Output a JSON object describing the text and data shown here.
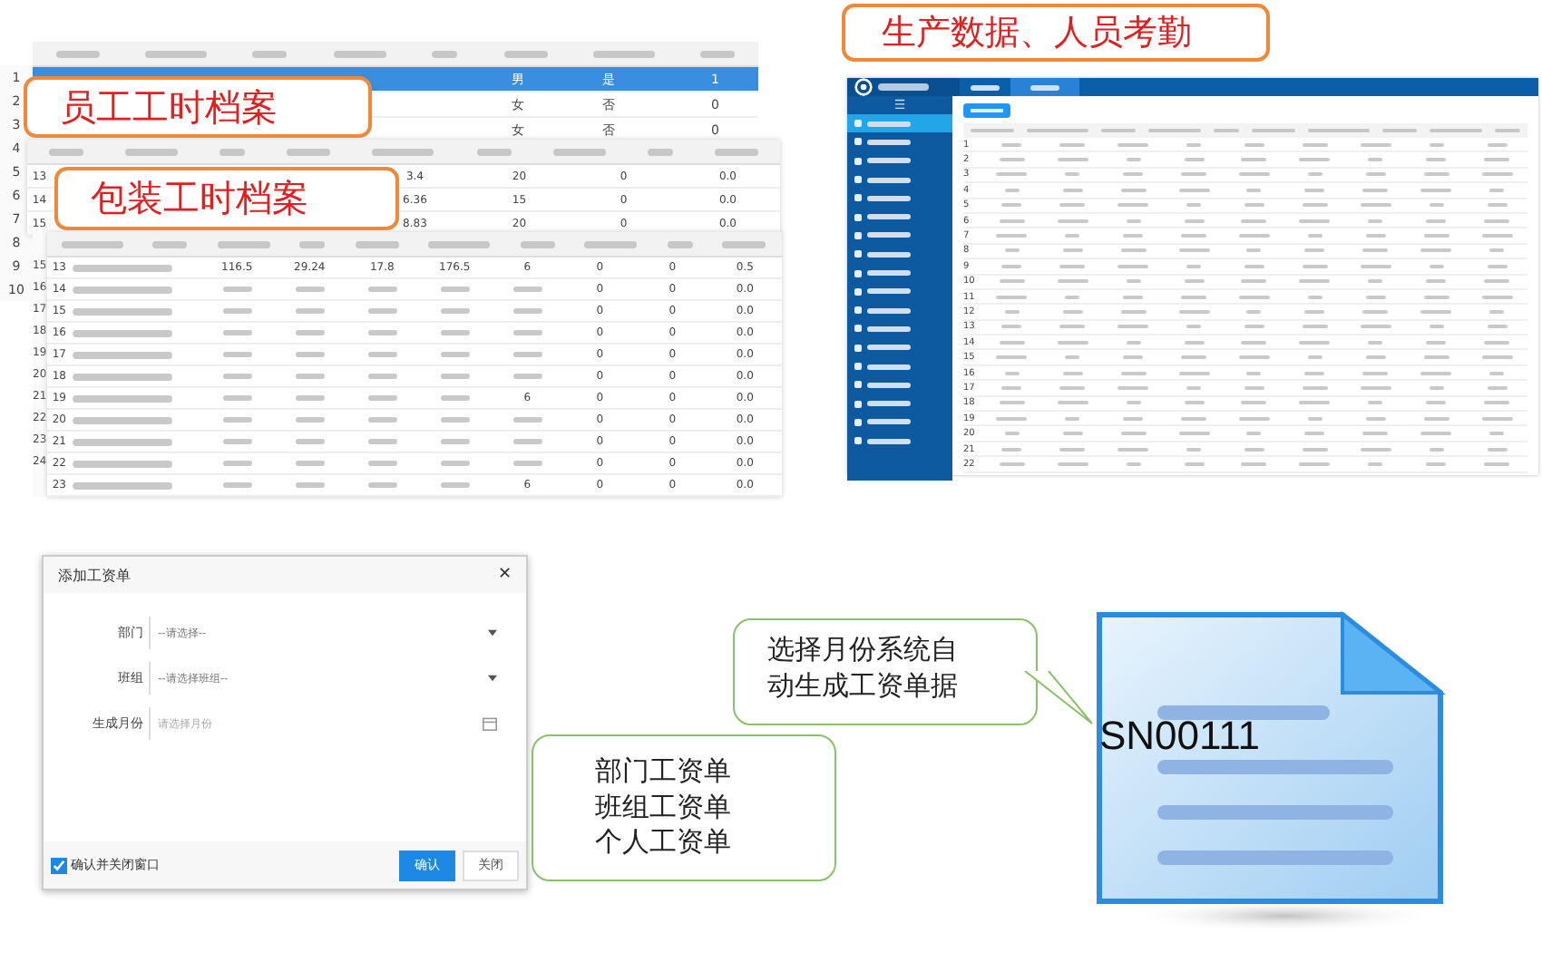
{
  "headings": {
    "attendance": "生产数据、人员考勤",
    "employee": "员工工时档案",
    "packaging": "包装工时档案"
  },
  "gutter": [
    "1",
    "2",
    "3",
    "4",
    "5",
    "6",
    "7",
    "8",
    "9",
    "10"
  ],
  "employee_table": {
    "rows": [
      {
        "selected": true,
        "cells": [
          "男",
          "是",
          "1"
        ]
      },
      {
        "selected": false,
        "cells": [
          "女",
          "否",
          "0"
        ]
      },
      {
        "selected": false,
        "cells": [
          "女",
          "否",
          "0"
        ]
      }
    ]
  },
  "packaging_table": {
    "rows": [
      {
        "index": "13",
        "cells": [
          "3.4",
          "20",
          "0",
          "0.0"
        ]
      },
      {
        "index": "14",
        "cells": [
          "6.36",
          "15",
          "0",
          "0.0"
        ]
      },
      {
        "index": "15",
        "cells": [
          "8.83",
          "20",
          "0",
          "0.0"
        ]
      }
    ]
  },
  "detail_table": {
    "gutter": [
      "15",
      "16",
      "17",
      "18",
      "19",
      "20",
      "21",
      "22",
      "23",
      "24"
    ],
    "rows": [
      {
        "index": "13",
        "cells": [
          "116.5",
          "29.24",
          "17.8",
          "176.5",
          "6",
          "0",
          "0",
          "0.5"
        ]
      },
      {
        "index": "14",
        "cells": [
          "",
          "",
          "",
          "",
          "",
          "0",
          "0",
          "0.0"
        ]
      },
      {
        "index": "15",
        "cells": [
          "",
          "",
          "",
          "",
          "",
          "0",
          "0",
          "0.0"
        ]
      },
      {
        "index": "16",
        "cells": [
          "",
          "",
          "",
          "",
          "",
          "0",
          "0",
          "0.0"
        ]
      },
      {
        "index": "17",
        "cells": [
          "",
          "",
          "",
          "",
          "",
          "0",
          "0",
          "0.0"
        ]
      },
      {
        "index": "18",
        "cells": [
          "",
          "",
          "",
          "",
          "",
          "0",
          "0",
          "0.0"
        ]
      },
      {
        "index": "19",
        "cells": [
          "",
          "",
          "",
          "",
          "6",
          "0",
          "0",
          "0.0"
        ]
      },
      {
        "index": "20",
        "cells": [
          "",
          "",
          "",
          "",
          "",
          "0",
          "0",
          "0.0"
        ]
      },
      {
        "index": "21",
        "cells": [
          "",
          "",
          "",
          "",
          "",
          "0",
          "0",
          "0.0"
        ]
      },
      {
        "index": "22",
        "cells": [
          "",
          "",
          "",
          "",
          "",
          "0",
          "0",
          "0.0"
        ]
      },
      {
        "index": "23",
        "cells": [
          "",
          "",
          "",
          "",
          "6",
          "0",
          "0",
          "0.0"
        ]
      }
    ]
  },
  "app": {
    "tabs": [
      {
        "selected": false
      },
      {
        "selected": true
      }
    ],
    "menu": [
      {
        "selected": true
      },
      {
        "selected": false
      },
      {
        "selected": false
      },
      {
        "selected": false
      },
      {
        "selected": false
      },
      {
        "selected": false
      },
      {
        "selected": false
      },
      {
        "selected": false
      },
      {
        "selected": false
      },
      {
        "selected": false
      },
      {
        "selected": false
      },
      {
        "selected": false
      },
      {
        "selected": false
      },
      {
        "selected": false
      },
      {
        "selected": false
      },
      {
        "selected": false
      },
      {
        "selected": false
      },
      {
        "selected": false
      }
    ],
    "rows": [
      "1",
      "2",
      "3",
      "4",
      "5",
      "6",
      "7",
      "8",
      "9",
      "10",
      "11",
      "12",
      "13",
      "14",
      "15",
      "16",
      "17",
      "18",
      "19",
      "20",
      "21",
      "22"
    ]
  },
  "dialog": {
    "title": "添加工资单",
    "fields": [
      {
        "label": "部门",
        "placeholder": "--请选择--",
        "kind": "select"
      },
      {
        "label": "班组",
        "placeholder": "--请选择班组--",
        "kind": "select"
      },
      {
        "label": "生成月份",
        "placeholder": "请选择月份",
        "kind": "date"
      }
    ],
    "close_option": {
      "label": "确认并关闭窗口",
      "checked": true
    },
    "buttons": [
      {
        "label": "确认",
        "kind": "primary"
      },
      {
        "label": "关闭",
        "kind": "plain"
      }
    ]
  },
  "bill_types": [
    "部门工资单",
    "班组工资单",
    "个人工资单"
  ],
  "auto_note": "选择月份系统自动生成工资单据",
  "document": {
    "code": "SN00111"
  },
  "glyphs": {
    "menu": "☰",
    "close": "✕"
  }
}
